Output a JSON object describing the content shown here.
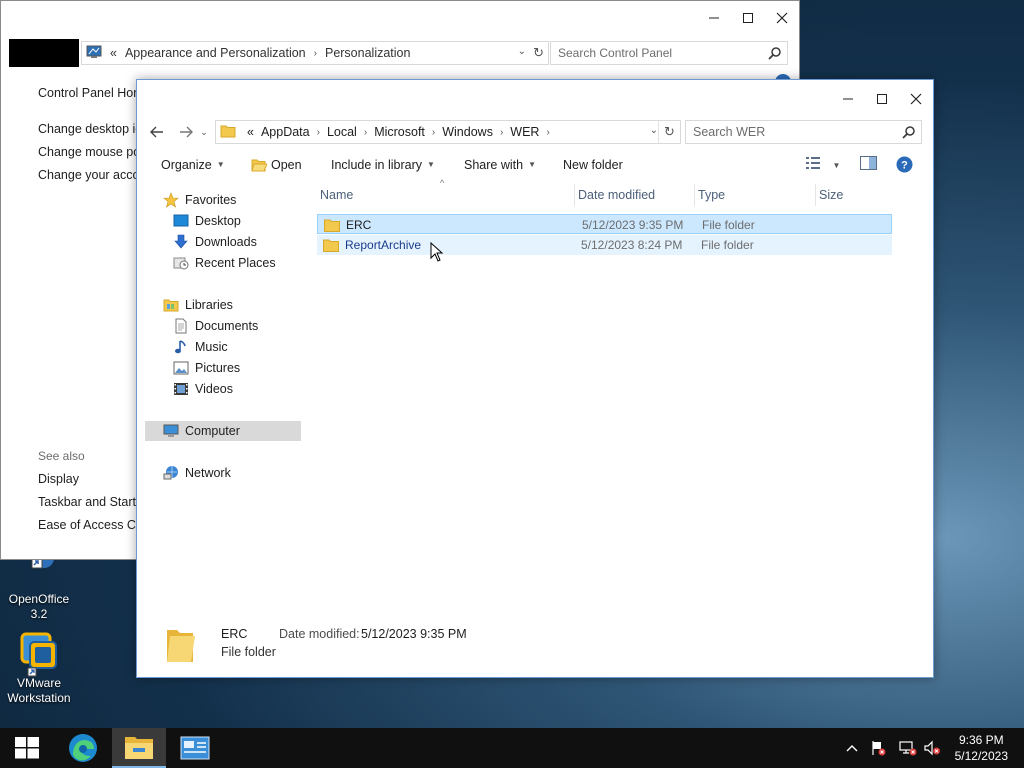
{
  "desktop": {
    "icons": [
      {
        "label": "OpenOffice 3.2"
      },
      {
        "label": "VMware Workstation"
      }
    ]
  },
  "control_panel": {
    "breadcrumb_overflow": "«",
    "breadcrumbs": [
      "Appearance and Personalization",
      "Personalization"
    ],
    "search_placeholder": "Search Control Panel",
    "sidebar_links": [
      "Control Panel Hom",
      "Change desktop ic",
      "Change mouse poi",
      "Change your accou"
    ],
    "see_also_label": "See also",
    "see_also_links": [
      "Display",
      "Taskbar and Start M",
      "Ease of Access Cen"
    ]
  },
  "explorer": {
    "breadcrumb_overflow": "«",
    "breadcrumbs": [
      "AppData",
      "Local",
      "Microsoft",
      "Windows",
      "WER"
    ],
    "search_placeholder": "Search WER",
    "toolbar": {
      "organize": "Organize",
      "open": "Open",
      "include_in_library": "Include in library",
      "share_with": "Share with",
      "new_folder": "New folder"
    },
    "nav": {
      "favorites": "Favorites",
      "desktop": "Desktop",
      "downloads": "Downloads",
      "recent_places": "Recent Places",
      "libraries": "Libraries",
      "documents": "Documents",
      "music": "Music",
      "pictures": "Pictures",
      "videos": "Videos",
      "computer": "Computer",
      "network": "Network"
    },
    "columns": [
      "Name",
      "Date modified",
      "Type",
      "Size"
    ],
    "rows": [
      {
        "name": "ERC",
        "date": "5/12/2023 9:35 PM",
        "type": "File folder",
        "size": ""
      },
      {
        "name": "ReportArchive",
        "date": "5/12/2023 8:24 PM",
        "type": "File folder",
        "size": ""
      }
    ],
    "details": {
      "name": "ERC",
      "type": "File folder",
      "date_label": "Date modified:",
      "date": "5/12/2023 9:35 PM"
    }
  },
  "taskbar": {
    "time": "9:36 PM",
    "date": "5/12/2023"
  },
  "colors": {
    "selection": "#cce8ff",
    "hover": "#e5f3ff",
    "window_border": "#6e9bd4",
    "taskbar": "#101010",
    "folder": "#f2c94c"
  }
}
